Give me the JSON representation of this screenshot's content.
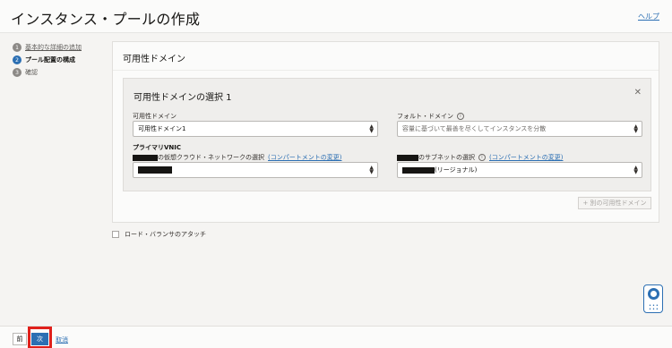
{
  "header": {
    "title": "インスタンス・プールの作成",
    "help_link": "ヘルプ"
  },
  "steps": [
    {
      "number": "1",
      "label": "基本的な詳細の追加",
      "state": "link"
    },
    {
      "number": "2",
      "label": "プール配置の構成",
      "state": "active"
    },
    {
      "number": "3",
      "label": "確認",
      "state": "inactive"
    }
  ],
  "panel": {
    "title": "可用性ドメイン",
    "card": {
      "title": "可用性ドメインの選択 1",
      "close_icon": "close-icon",
      "availability_domain": {
        "label": "可用性ドメイン",
        "value": "可用性ドメイン1"
      },
      "fault_domain": {
        "label": "フォルト・ドメイン",
        "placeholder": "容量に基づいて最善を尽くしてインスタンスを分散"
      },
      "primary_vnic": {
        "heading": "プライマリVNIC",
        "vcn_label": "の仮想クラウド・ネットワークの選択",
        "vcn_compartment_link": "(コンパートメントの変更)",
        "subnet_label": "のサブネットの選択",
        "subnet_compartment_link": "(コンパートメントの変更)",
        "subnet_value": "(リージョナル)"
      }
    },
    "add_button": "+ 別の可用性ドメイン"
  },
  "load_balancer": {
    "label": "ロード・バランサのアタッチ"
  },
  "footer": {
    "back": "前",
    "next": "次",
    "cancel": "取消"
  },
  "colors": {
    "accent": "#2c6fb3",
    "highlight": "#e0201b"
  }
}
